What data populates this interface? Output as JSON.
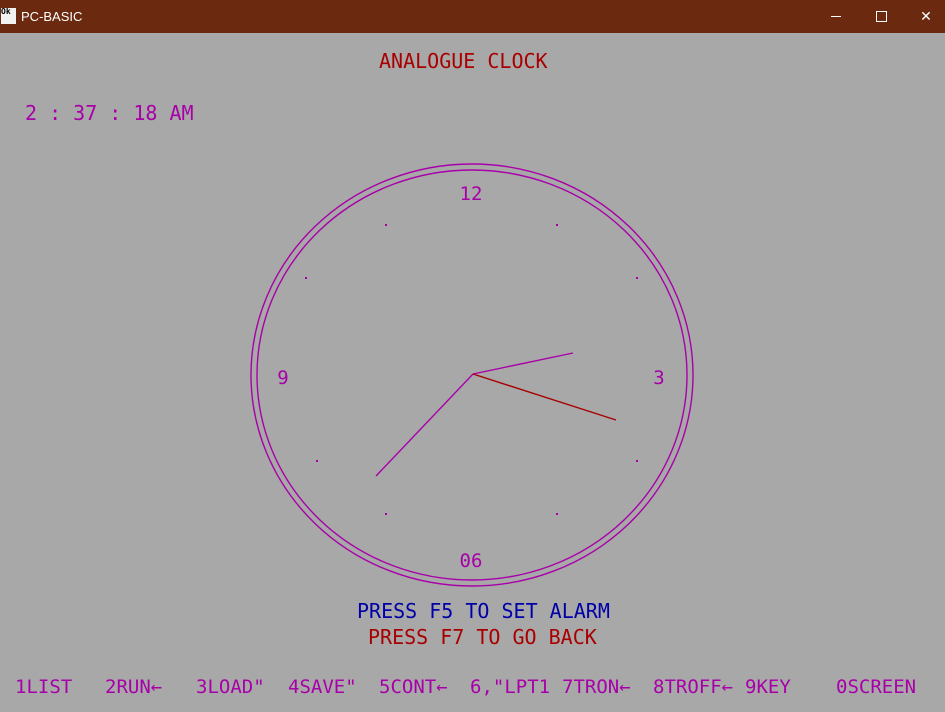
{
  "window": {
    "title": "PC-BASIC",
    "icon_text_top": "Ok",
    "icon_name": "pc-basic-app-icon",
    "controls": {
      "minimize_icon": "minimize-icon",
      "maximize_icon": "maximize-icon",
      "close_icon": "close-icon",
      "close_glyph": "✕"
    }
  },
  "colors": {
    "background": "#a8a8a8",
    "titlebar": "#6b2a0f",
    "magenta": "#a800a8",
    "red": "#a80000",
    "blue": "#0000a8"
  },
  "screen": {
    "heading": "ANALOGUE CLOCK",
    "time_display": "2 : 37 : 18 AM",
    "instruction_alarm": "PRESS F5 TO SET ALARM",
    "instruction_back": "PRESS F7 TO GO BACK"
  },
  "clock": {
    "numerals": {
      "top": "12",
      "right": "3",
      "bottom": "06",
      "left": "9"
    },
    "time": {
      "hour": 2,
      "minute": 37,
      "second": 18
    }
  },
  "function_keys": [
    {
      "label": "1LIST"
    },
    {
      "label": "2RUN←"
    },
    {
      "label": "3LOAD\""
    },
    {
      "label": "4SAVE\""
    },
    {
      "label": "5CONT←"
    },
    {
      "label": "6,\"LPT1"
    },
    {
      "label": "7TRON←"
    },
    {
      "label": "8TROFF←"
    },
    {
      "label": "9KEY"
    },
    {
      "label": "0SCREEN"
    }
  ]
}
